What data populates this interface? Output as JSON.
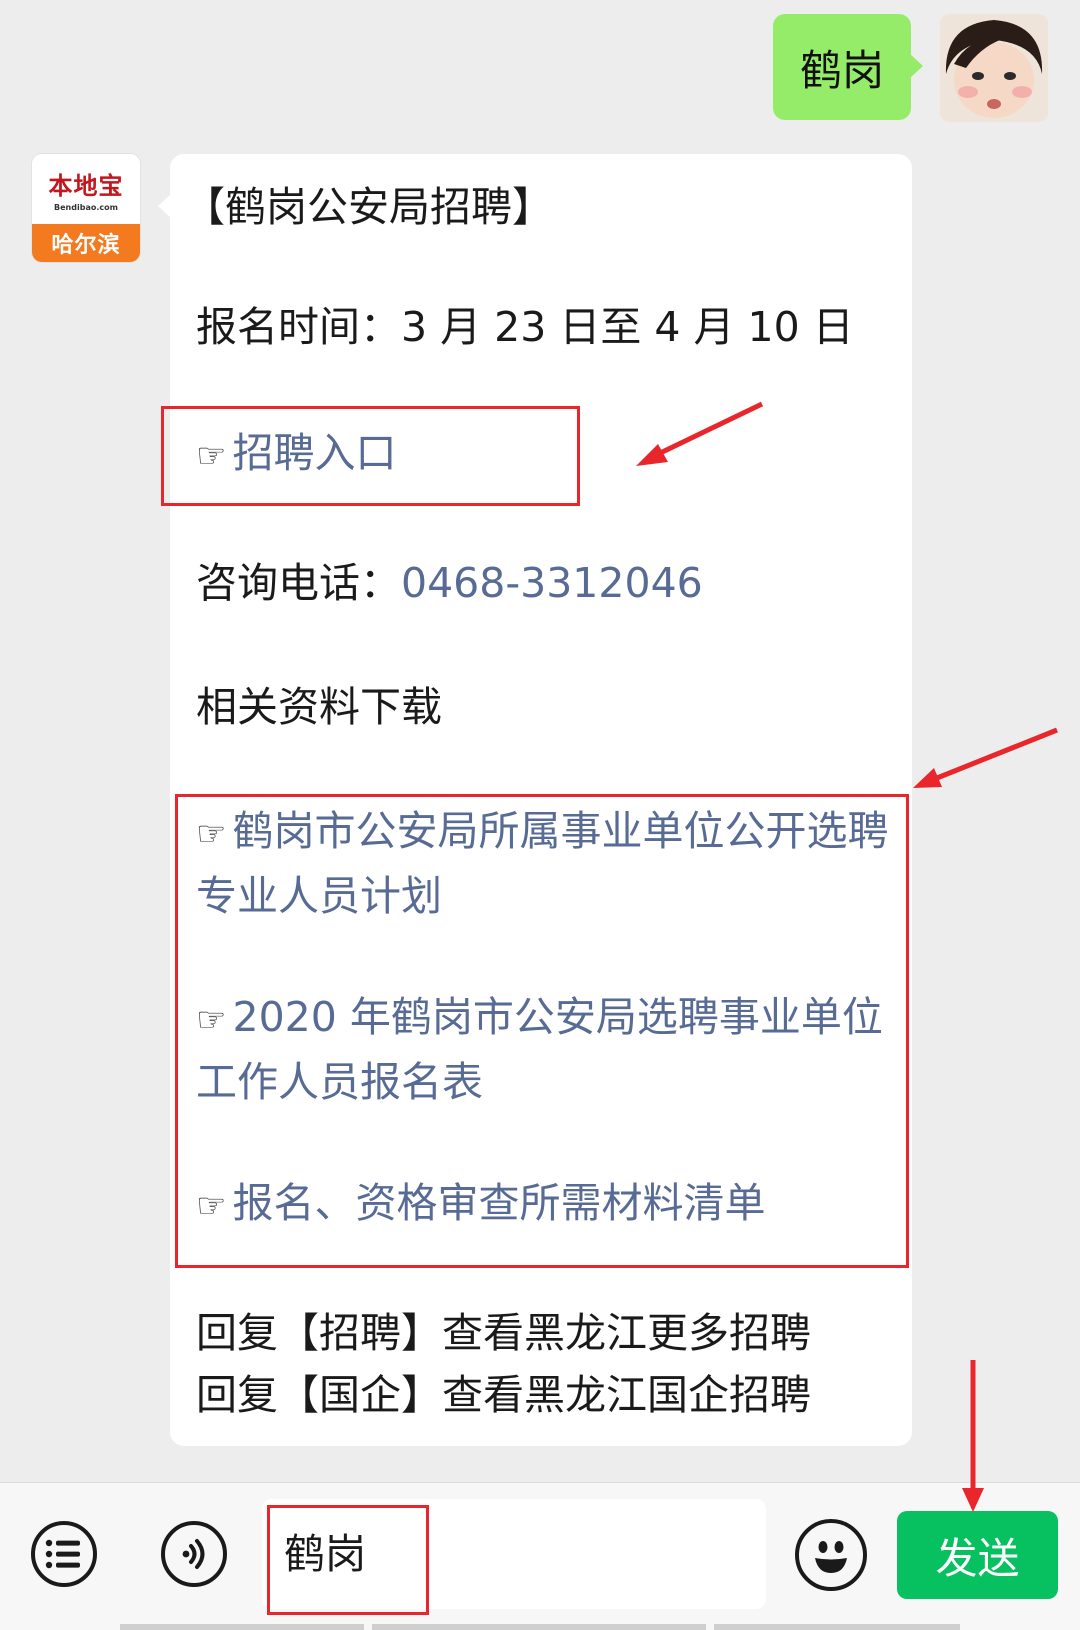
{
  "sent": {
    "text": "鹤岗"
  },
  "bot": {
    "avatar_brand": "本地宝",
    "avatar_url": "Bendibao.com",
    "avatar_city": "哈尔滨"
  },
  "message": {
    "title": "【鹤岗公安局招聘】",
    "signup_time": "报名时间：3 月 23 日至 4 月 10 日",
    "entry_link": "招聘入口",
    "phone_label": "咨询电话：",
    "phone_number": "0468-3312046",
    "downloads_heading": "相关资料下载",
    "downloads": [
      "鹤岗市公安局所属事业单位公开选聘专业人员计划",
      "2020 年鹤岗市公安局选聘事业单位工作人员报名表",
      "报名、资格审查所需材料清单"
    ],
    "reply_1": "回复【招聘】查看黑龙江更多招聘",
    "reply_2": "回复【国企】查看黑龙江国企招聘",
    "hand_glyph": "☞"
  },
  "input": {
    "value": "鹤岗",
    "send_label": "发送"
  },
  "colors": {
    "link": "#576b95",
    "sent_bubble": "#95ec69",
    "send_button": "#07c160",
    "highlight": "#e8262b"
  },
  "icons": [
    "list-icon",
    "voice-icon",
    "emoji-icon",
    "pointing-hand-icon"
  ]
}
